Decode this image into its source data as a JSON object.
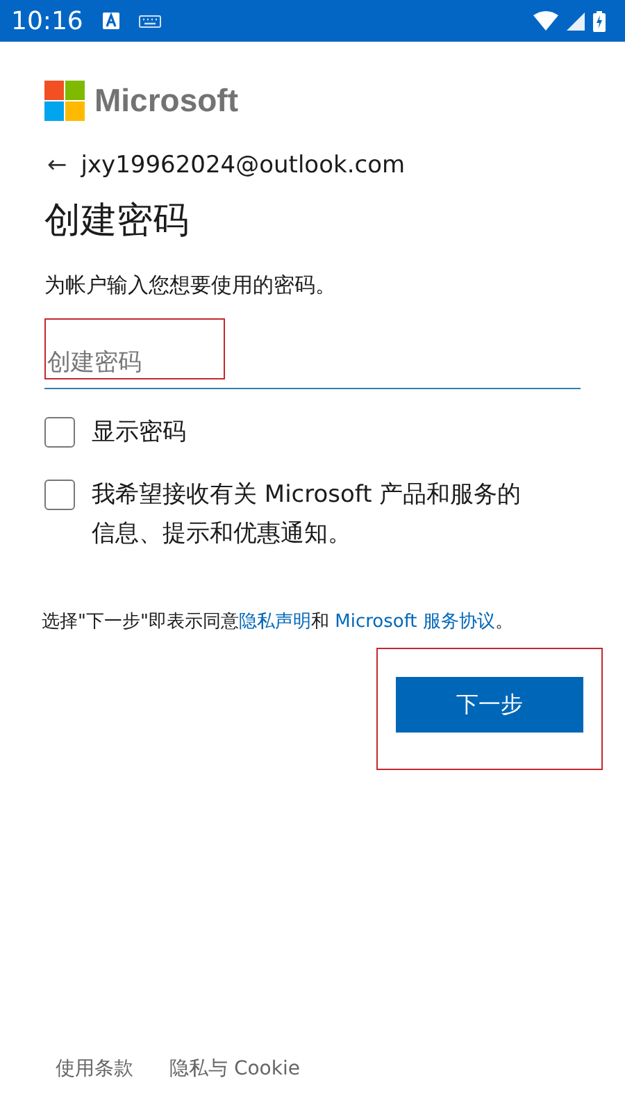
{
  "status_bar": {
    "time": "10:16"
  },
  "brand": {
    "name": "Microsoft"
  },
  "account": {
    "back": "←",
    "email": "jxy19962024@outlook.com"
  },
  "title": "创建密码",
  "description": "为帐户输入您想要使用的密码。",
  "password_field": {
    "placeholder": "创建密码",
    "highlighted": true
  },
  "options": [
    {
      "label": "显示密码",
      "checked": false
    },
    {
      "label": "我希望接收有关 Microsoft 产品和服务的信息、提示和优惠通知。",
      "checked": false
    }
  ],
  "legal": {
    "before": "选择\"下一步\"即表示同意",
    "links": [
      "隐私声明",
      "Microsoft 服务协议"
    ],
    "between": "和 ",
    "after": "。"
  },
  "next_button": {
    "label": "下一步",
    "highlighted": true
  },
  "footer": [
    "使用条款",
    "隐私与 Cookie"
  ]
}
